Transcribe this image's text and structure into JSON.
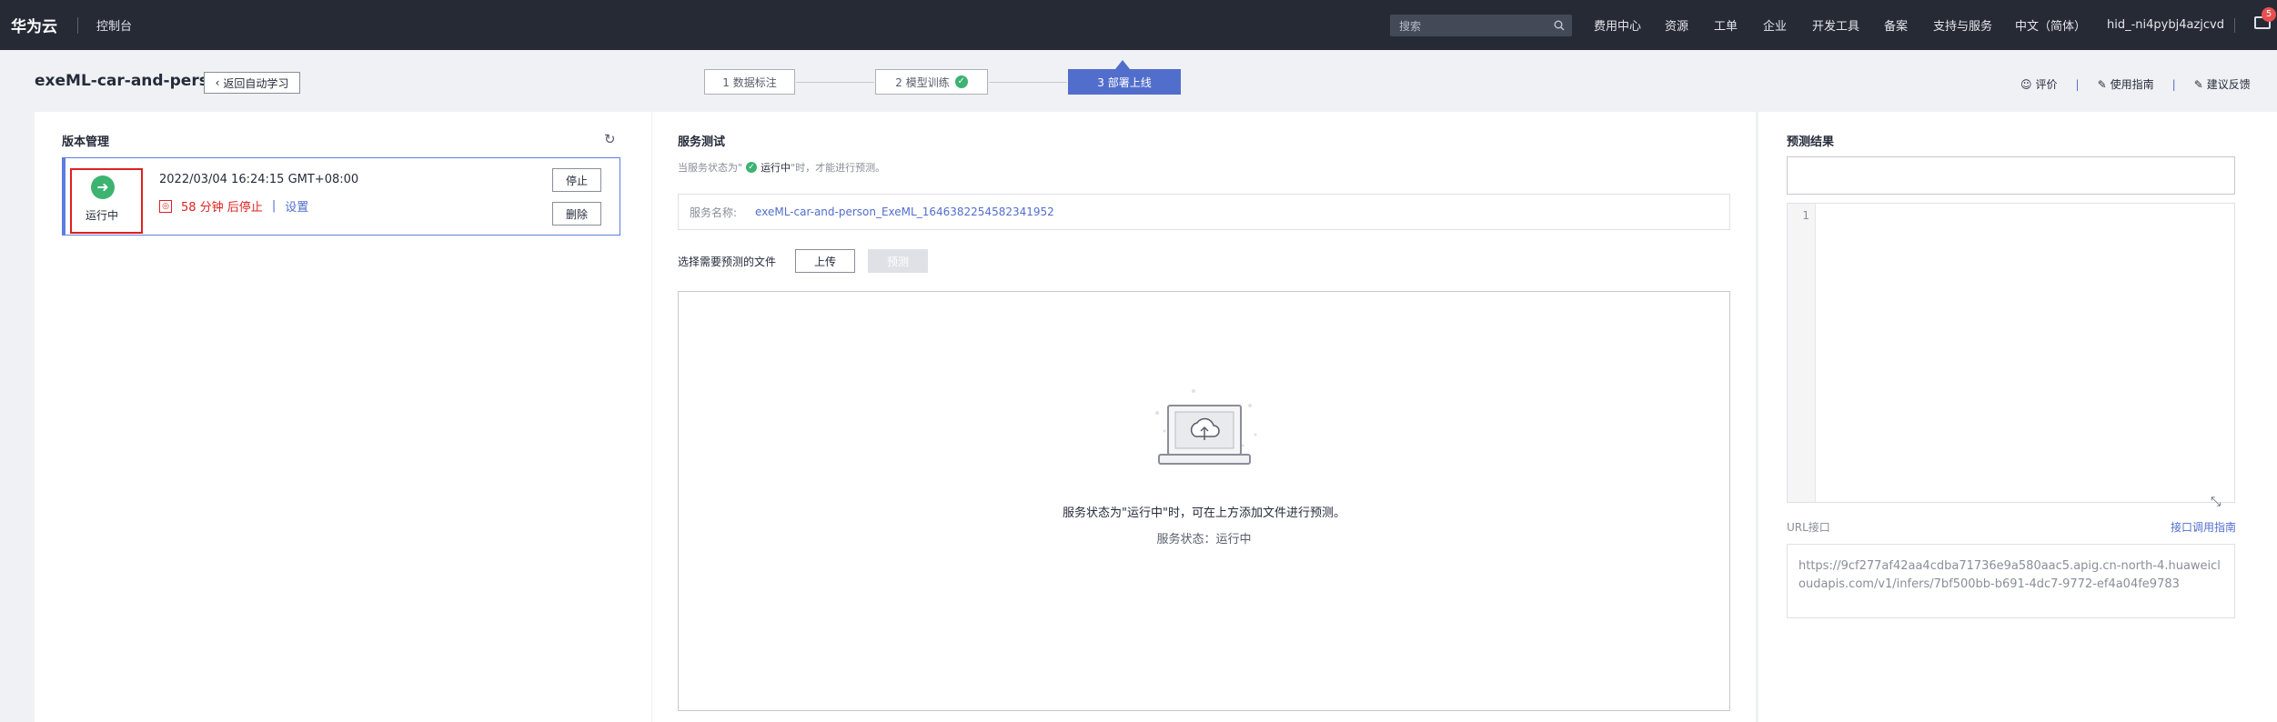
{
  "topbar": {
    "brand": "华为云",
    "console": "控制台",
    "search_placeholder": "搜索",
    "nav": [
      "费用中心",
      "资源",
      "工单",
      "企业",
      "开发工具",
      "备案",
      "支持与服务",
      "中文（简体）",
      "hid_-ni4pybj4azjcvd"
    ],
    "mail_badge": "5"
  },
  "header": {
    "project_title": "exeML-car-and-person",
    "back_label": "返回自动学习",
    "steps": [
      "1 数据标注",
      "2 模型训练",
      "3 部署上线"
    ],
    "links": [
      "评价",
      "使用指南",
      "建议反馈"
    ]
  },
  "version_panel": {
    "title": "版本管理",
    "card": {
      "status": "运行中",
      "timestamp": "2022/03/04 16:24:15 GMT+08:00",
      "remaining": "58 分钟 后停止",
      "separator": "|",
      "settings": "设置",
      "stop_label": "停止",
      "delete_label": "删除"
    }
  },
  "test_panel": {
    "title": "服务测试",
    "hint_prefix": "当服务状态为\"",
    "hint_status": "运行中",
    "hint_suffix": "\"时，才能进行预测。",
    "service_name_label": "服务名称:",
    "service_name_value": "exeML-car-and-person_ExeML_1646382254582341952",
    "file_label": "选择需要预测的文件",
    "upload_label": "上传",
    "predict_label": "预测",
    "upload_message": "服务状态为\"运行中\"时，可在上方添加文件进行预测。",
    "service_status": "服务状态：运行中"
  },
  "result_panel": {
    "title": "预测结果",
    "editor_line": "1",
    "url_label": "URL接口",
    "api_guide": "接口调用指南",
    "url_value": "https://9cf277af42aa4cdba71736e9a580aac5.apig.cn-north-4.huaweicloudapis.com/v1/infers/7bf500bb-b691-4dc7-9772-ef4a04fe9783"
  }
}
